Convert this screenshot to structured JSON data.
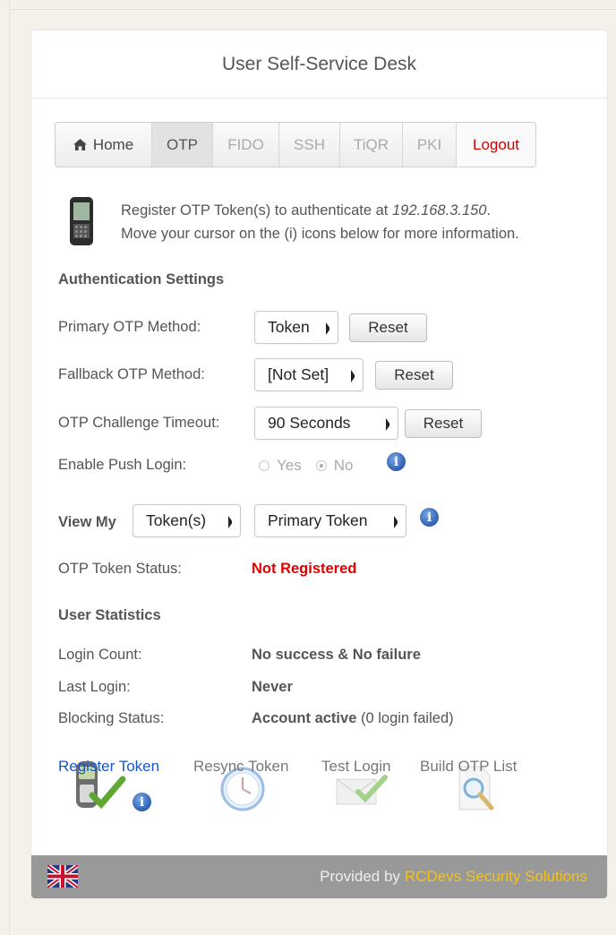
{
  "header": {
    "title": "User Self-Service Desk"
  },
  "nav": {
    "home": "Home",
    "otp": "OTP",
    "fido": "FIDO",
    "ssh": "SSH",
    "tiqr": "TiQR",
    "pki": "PKI",
    "logout": "Logout"
  },
  "intro": {
    "line1_prefix": "Register OTP Token(s) to authenticate at ",
    "host": "192.168.3.150",
    "line1_suffix": ".",
    "line2": "Move your cursor on the (i) icons below for more information."
  },
  "auth_settings": {
    "heading": "Authentication Settings",
    "primary_label": "Primary OTP Method:",
    "primary_value": "Token",
    "fallback_label": "Fallback OTP Method:",
    "fallback_value": "[Not Set]",
    "timeout_label": "OTP Challenge Timeout:",
    "timeout_value": "90 Seconds",
    "reset_label": "Reset",
    "push_label": "Enable Push Login:",
    "push_yes": "Yes",
    "push_no": "No",
    "push_selected": "No"
  },
  "view": {
    "label": "View My",
    "select1": "Token(s)",
    "select2": "Primary Token"
  },
  "token_status": {
    "label": "OTP Token Status:",
    "value": "Not Registered"
  },
  "stats": {
    "heading": "User Statistics",
    "login_count_label": "Login Count:",
    "login_count_value": "No success & No failure",
    "last_login_label": "Last Login:",
    "last_login_value": "Never",
    "blocking_label": "Blocking Status:",
    "blocking_value": "Account active",
    "blocking_note": "(0 login failed)"
  },
  "actions": {
    "register": "Register Token",
    "resync": "Resync Token",
    "test": "Test Login",
    "build": "Build OTP List"
  },
  "footer": {
    "prefix": "Provided by",
    "brand": "RCDevs Security Solutions"
  },
  "colors": {
    "accent_link": "#1a56c8",
    "error": "#e00000",
    "logout": "#d40000",
    "brand": "#f2c21b"
  },
  "icons": [
    "home-icon",
    "phone-token-icon",
    "info-icon",
    "clock-icon",
    "envelope-check-icon",
    "document-search-icon",
    "uk-flag-icon"
  ]
}
